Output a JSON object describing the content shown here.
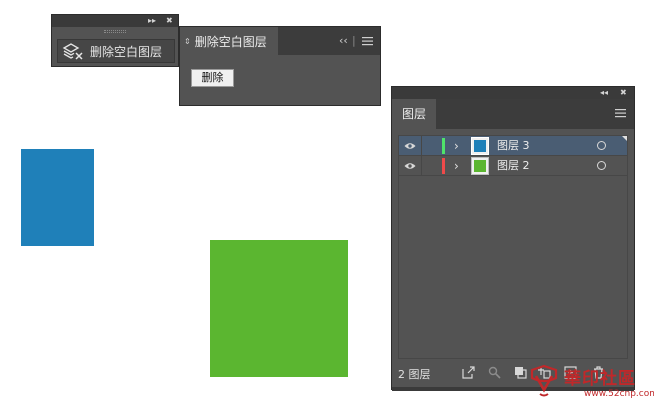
{
  "canvas": {
    "shapes": [
      {
        "name": "blue-rectangle",
        "color": "#1f80b9"
      },
      {
        "name": "green-rectangle",
        "color": "#5bb630"
      }
    ]
  },
  "collapsed_panel": {
    "topbar_controls": [
      "▸▸",
      "✖"
    ],
    "script_button_label": "删除空白图层",
    "script_button_icon": "layers-delete-icon"
  },
  "delete_panel": {
    "tab_label": "删除空白图层",
    "tab_arrow": "⇕",
    "collapse_label": "‹‹",
    "separator": "|",
    "menu_icon": "menu-icon",
    "action_button_label": "删除"
  },
  "layers_panel": {
    "topbar_controls": [
      "◂◂",
      "✖"
    ],
    "tab_label": "图层",
    "menu_icon": "menu-icon",
    "layers": [
      {
        "name": "图层 3",
        "color_tag": "#4fe36a",
        "thumb_color": "#1f80b9",
        "selected": true,
        "expand": "›"
      },
      {
        "name": "图层 2",
        "color_tag": "#ef4a4a",
        "thumb_color": "#5bb630",
        "selected": false,
        "expand": "›"
      }
    ],
    "footer": {
      "count_label": "2 图层",
      "icons": [
        "export-icon",
        "search-icon",
        "clip-icon",
        "new-sublayer-icon",
        "new-layer-icon",
        "delete-icon"
      ]
    }
  },
  "watermark": {
    "brand": "華印社區",
    "url": "www.52cnp.com"
  }
}
